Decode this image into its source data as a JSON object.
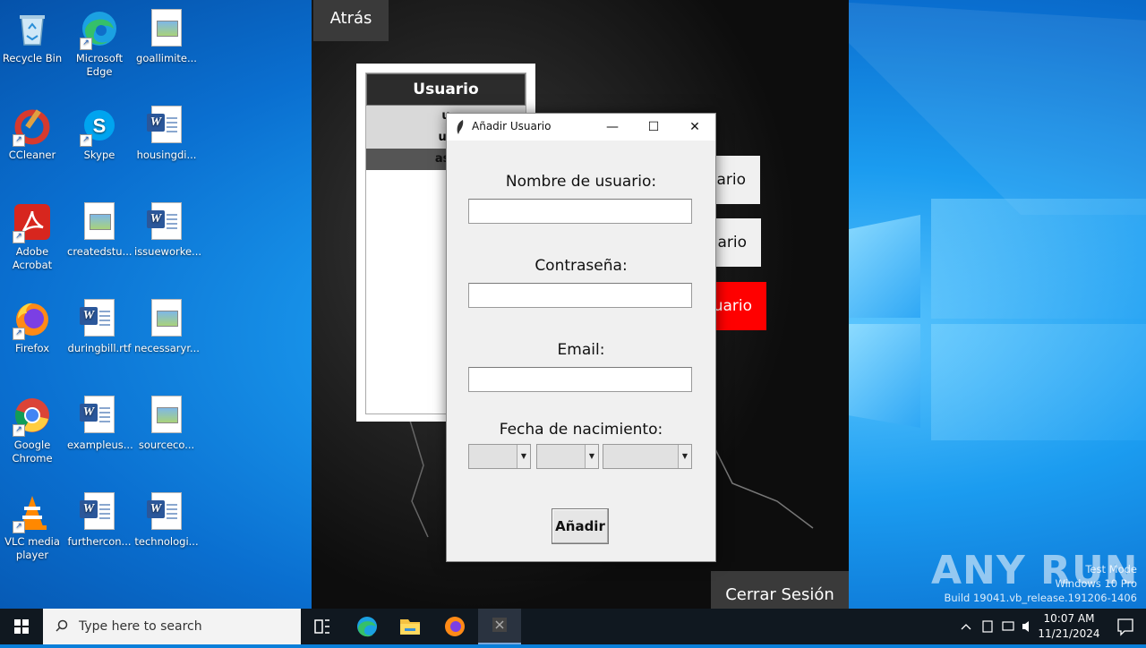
{
  "desktop": {
    "icons": [
      {
        "label": "Recycle Bin",
        "kind": "recycle"
      },
      {
        "label": "Microsoft Edge",
        "kind": "edge"
      },
      {
        "label": "goallimite...",
        "kind": "image"
      },
      {
        "label": "CCleaner",
        "kind": "ccleaner"
      },
      {
        "label": "Skype",
        "kind": "skype"
      },
      {
        "label": "housingdi...",
        "kind": "word"
      },
      {
        "label": "Adobe Acrobat",
        "kind": "acrobat"
      },
      {
        "label": "createdstu...",
        "kind": "image"
      },
      {
        "label": "issueworke...",
        "kind": "word"
      },
      {
        "label": "Firefox",
        "kind": "firefox"
      },
      {
        "label": "duringbill.rtf",
        "kind": "word"
      },
      {
        "label": "necessaryr...",
        "kind": "image"
      },
      {
        "label": "Google Chrome",
        "kind": "chrome"
      },
      {
        "label": "exampleus...",
        "kind": "word"
      },
      {
        "label": "sourceco...",
        "kind": "image"
      },
      {
        "label": "VLC media player",
        "kind": "vlc"
      },
      {
        "label": "furthercon...",
        "kind": "word"
      },
      {
        "label": "technologi...",
        "kind": "word"
      }
    ]
  },
  "app": {
    "back_label": "Atrás",
    "list_header": "Usuario",
    "list_rows": [
      "u",
      "us",
      "asc"
    ],
    "action_buttons": [
      "ario",
      "ario",
      "uario"
    ],
    "logout_label": "Cerrar Sesión"
  },
  "dialog": {
    "title": "Añadir Usuario",
    "username_label": "Nombre de usuario:",
    "password_label": "Contraseña:",
    "email_label": "Email:",
    "birthdate_label": "Fecha de nacimiento:",
    "submit_label": "Añadir",
    "minimize_glyph": "—",
    "maximize_glyph": "☐",
    "close_glyph": "✕"
  },
  "watermark": {
    "brand": "ANY RUN",
    "line1": "Test Mode",
    "line2": "Windows 10 Pro",
    "line3": "Build 19041.vb_release.191206-1406"
  },
  "taskbar": {
    "search_placeholder": "Type here to search",
    "time": "10:07 AM",
    "date": "11/21/2024"
  },
  "colors": {
    "accent_red": "#ff0000",
    "app_bg": "#0d0d0d",
    "dialog_bg": "#f0f0f0"
  }
}
